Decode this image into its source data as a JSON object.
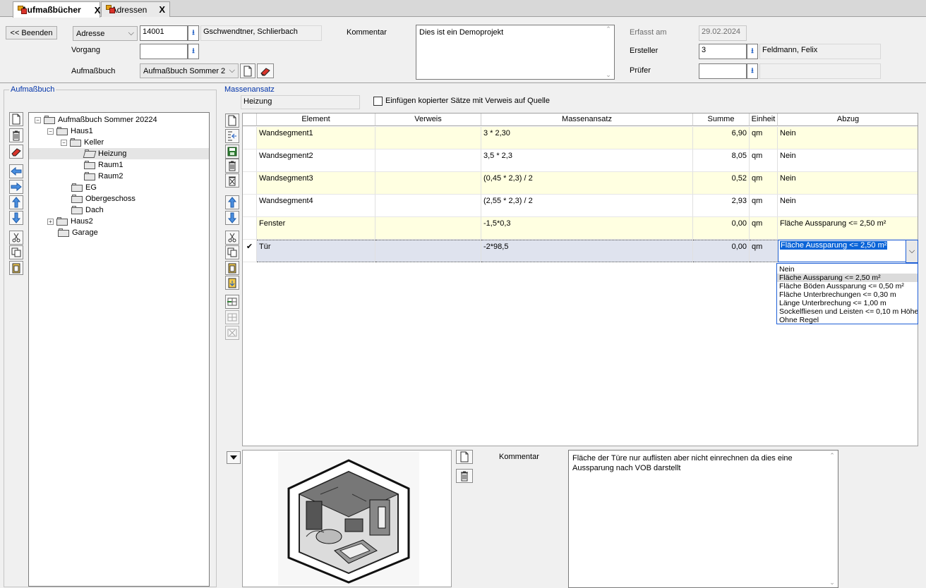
{
  "tabs": [
    {
      "label": "Aufmaßbücher",
      "close": "X"
    },
    {
      "label": "Adressen",
      "close": "X"
    }
  ],
  "header": {
    "back_button": "<< Beenden",
    "adresse_combo": "Adresse",
    "adresse_value": "14001",
    "adresse_name": "Gschwendtner, Schlierbach",
    "vorgang_label": "Vorgang",
    "vorgang_value": "",
    "aufmassbuch_label": "Aufmaßbuch",
    "aufmassbuch_value": "Aufmaßbuch Sommer 2",
    "kommentar_label": "Kommentar",
    "kommentar_value": "Dies ist ein Demoprojekt",
    "erfasst_label": "Erfasst am",
    "erfasst_value": "29.02.2024",
    "ersteller_label": "Ersteller",
    "ersteller_value": "3",
    "ersteller_name": "Feldmann, Felix",
    "pruefer_label": "Prüfer",
    "pruefer_value": "",
    "pruefer_name": ""
  },
  "left_panel": {
    "title": "Aufmaßbuch",
    "tree": [
      {
        "label": "Aufmaßbuch Sommer 20224",
        "expander": "−"
      },
      {
        "label": "Haus1",
        "expander": "−"
      },
      {
        "label": "Keller",
        "expander": "−"
      },
      {
        "label": "Heizung",
        "selected": true
      },
      {
        "label": "Raum1"
      },
      {
        "label": "Raum2"
      },
      {
        "label": "EG"
      },
      {
        "label": "Obergeschoss"
      },
      {
        "label": "Dach"
      },
      {
        "label": "Haus2",
        "expander": "+"
      },
      {
        "label": "Garage"
      }
    ]
  },
  "massenansatz": {
    "title": "Massenansatz",
    "current": "Heizung",
    "checkbox_label": "Einfügen kopierter Sätze mit Verweis auf Quelle",
    "checkbox_checked": false,
    "columns": [
      "Element",
      "Verweis",
      "Massenansatz",
      "Summe",
      "Einheit",
      "Abzug"
    ],
    "rows": [
      {
        "element": "Wandsegment1",
        "verweis": "",
        "ansatz": "3 * 2,30",
        "summe": "6,90",
        "einheit": "qm",
        "abzug": "Nein",
        "style": "y"
      },
      {
        "element": "Wandsegment2",
        "verweis": "",
        "ansatz": "3,5 * 2,3",
        "summe": "8,05",
        "einheit": "qm",
        "abzug": "Nein",
        "style": "w"
      },
      {
        "element": "Wandsegment3",
        "verweis": "",
        "ansatz": "(0,45 * 2,3) / 2",
        "summe": "0,52",
        "einheit": "qm",
        "abzug": "Nein",
        "style": "y"
      },
      {
        "element": "Wandsegment4",
        "verweis": "",
        "ansatz": "(2,55 * 2,3) / 2",
        "summe": "2,93",
        "einheit": "qm",
        "abzug": "Nein",
        "style": "w"
      },
      {
        "element": "Fenster",
        "verweis": "",
        "ansatz": "-1,5*0,3",
        "summe": "0,00",
        "einheit": "qm",
        "abzug": "Fläche Aussparung <= 2,50 m²",
        "style": "y"
      },
      {
        "element": "Tür",
        "verweis": "",
        "ansatz": "-2*98,5",
        "summe": "0,00",
        "einheit": "qm",
        "abzug": "Fläche Aussparung <= 2,50 m²",
        "style": "sel"
      }
    ],
    "row_marker": "✔",
    "dropdown_options": [
      "Nein",
      "Fläche Aussparung <= 2,50 m²",
      "Fläche Böden Aussparung <= 0,50 m²",
      "Fläche Unterbrechungen <= 0,30 m",
      "Länge Unterbrechung <= 1,00 m",
      "Sockelfliesen und Leisten <= 0,10 m Höhe",
      "Ohne Regel"
    ],
    "dropdown_highlight": 1
  },
  "bottom": {
    "kommentar_label": "Kommentar",
    "kommentar_text": "Fläche der Türe nur auflisten aber nicht einrechnen da dies eine Aussparung nach VOB darstellt"
  },
  "icons": {
    "lookup": "download-arrow-icon",
    "new": "new-document-icon",
    "delete": "trash-icon",
    "eraser": "eraser-icon",
    "save": "save-disk-icon",
    "cut": "scissors-icon",
    "copy": "copy-icon",
    "paste": "clipboard-icon"
  },
  "colors": {
    "row_yellow": "#ffffe1",
    "row_selected": "#dfe3ee",
    "group_title": "#0033aa",
    "selection_blue": "#1e5fd6"
  }
}
